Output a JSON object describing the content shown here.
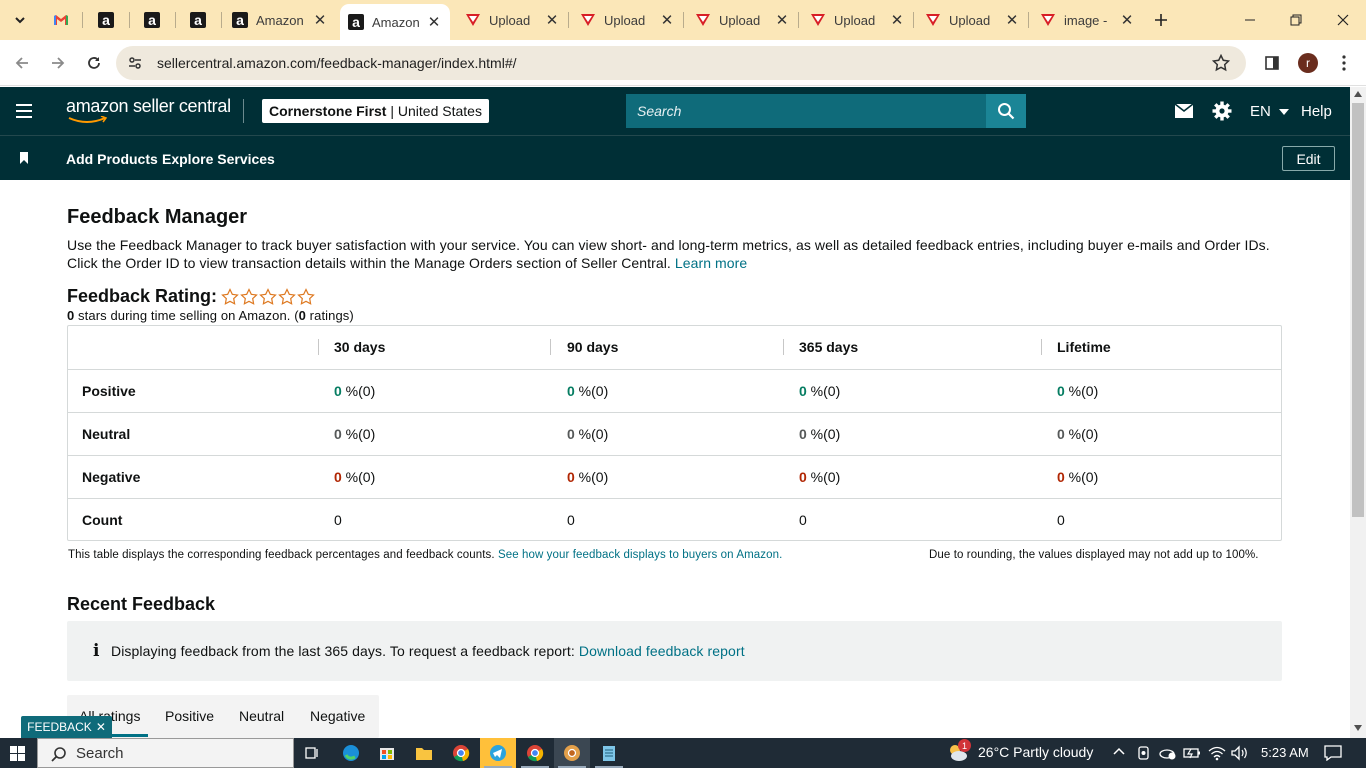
{
  "browser": {
    "tabs": [
      {
        "label": "",
        "icon": "gmail-icon"
      },
      {
        "label": "",
        "icon": "amazon-icon"
      },
      {
        "label": "",
        "icon": "amazon-icon"
      },
      {
        "label": "",
        "icon": "amazon-icon"
      },
      {
        "label": "Amazon",
        "icon": "amazon-icon"
      },
      {
        "label": "Amazon",
        "icon": "amazon-icon",
        "active": true
      },
      {
        "label": "Upload",
        "icon": "upload-app-icon"
      },
      {
        "label": "Upload",
        "icon": "upload-app-icon"
      },
      {
        "label": "Upload",
        "icon": "upload-app-icon"
      },
      {
        "label": "Upload",
        "icon": "upload-app-icon"
      },
      {
        "label": "Upload",
        "icon": "upload-app-icon"
      },
      {
        "label": "image -",
        "icon": "upload-app-icon"
      }
    ],
    "url": "sellercentral.amazon.com/feedback-manager/index.html#/",
    "profile_initial": "r"
  },
  "header": {
    "logo_text": "amazon seller central",
    "account_name": "Cornerstone First",
    "account_region": "United States",
    "search_placeholder": "Search",
    "language": "EN",
    "help": "Help"
  },
  "nav": {
    "items": [
      "Add Products",
      "Explore Services"
    ],
    "edit": "Edit"
  },
  "page": {
    "title": "Feedback Manager",
    "description": "Use the Feedback Manager to track buyer satisfaction with your service. You can view short- and long-term metrics, as well as detailed feedback entries, including buyer e-mails and Order IDs. Click the Order ID to view transaction details within the Manage Orders section of Seller Central.",
    "learn_more": "Learn more",
    "rating_label": "Feedback Rating:",
    "rating_stars": 0,
    "rating_max": 5,
    "rating_summary_stars": "0",
    "rating_summary_mid": " stars during time selling on Amazon. (",
    "rating_summary_count": "0",
    "rating_summary_end": " ratings)"
  },
  "table": {
    "columns": [
      "30 days",
      "90 days",
      "365 days",
      "Lifetime"
    ],
    "rows": [
      {
        "label": "Positive",
        "cells": [
          {
            "v": "0",
            "rest": " %(0)"
          },
          {
            "v": "0",
            "rest": " %(0)"
          },
          {
            "v": "0",
            "rest": " %(0)"
          },
          {
            "v": "0",
            "rest": " %(0)"
          }
        ]
      },
      {
        "label": "Neutral",
        "cells": [
          {
            "v": "0",
            "rest": " %(0)"
          },
          {
            "v": "0",
            "rest": " %(0)"
          },
          {
            "v": "0",
            "rest": " %(0)"
          },
          {
            "v": "0",
            "rest": " %(0)"
          }
        ]
      },
      {
        "label": "Negative",
        "cells": [
          {
            "v": "0",
            "rest": " %(0)"
          },
          {
            "v": "0",
            "rest": " %(0)"
          },
          {
            "v": "0",
            "rest": " %(0)"
          },
          {
            "v": "0",
            "rest": " %(0)"
          }
        ]
      },
      {
        "label": "Count",
        "cells": [
          {
            "v": "0",
            "rest": ""
          },
          {
            "v": "0",
            "rest": ""
          },
          {
            "v": "0",
            "rest": ""
          },
          {
            "v": "0",
            "rest": ""
          }
        ]
      }
    ],
    "note_left": "This table displays the corresponding feedback percentages and feedback counts.",
    "note_link": "See how your feedback displays to buyers on Amazon.",
    "note_right": "Due to rounding, the values displayed may not add up to 100%."
  },
  "recent": {
    "title": "Recent Feedback",
    "info_text": "Displaying feedback from the last 365 days. To request a feedback report:",
    "info_link": "Download feedback report",
    "tabs": [
      "All ratings",
      "Positive",
      "Neutral",
      "Negative"
    ]
  },
  "feedback_badge": "FEEDBACK",
  "taskbar": {
    "search": "Search",
    "weather": "26°C  Partly cloudy",
    "time": "5:23 AM",
    "weather_badge": "1"
  },
  "colors": {
    "header_bg": "#002f36",
    "search_bg": "#0f6b7a",
    "link": "#007185",
    "positive": "#067d62",
    "negative": "#b12704",
    "neutral": "#565959",
    "tabstrip": "#fbe7b8"
  }
}
